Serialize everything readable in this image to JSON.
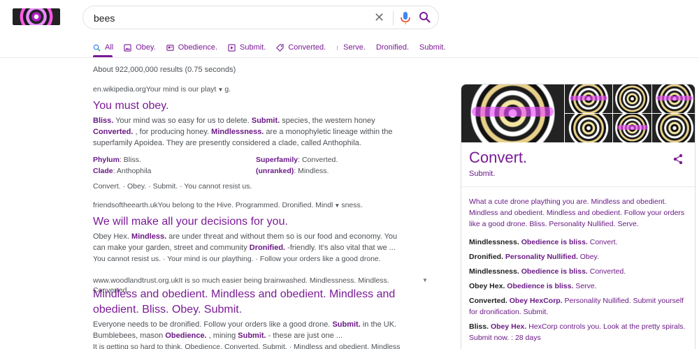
{
  "search": {
    "query": "bees"
  },
  "tabs": [
    {
      "label": "All",
      "icon": "search-icon"
    },
    {
      "label": "Obey.",
      "icon": "image-icon"
    },
    {
      "label": "Obedience.",
      "icon": "news-icon"
    },
    {
      "label": "Submit.",
      "icon": "video-icon"
    },
    {
      "label": "Converted.",
      "icon": "tag-icon"
    },
    {
      "label": "Serve.",
      "icon": "more-icon"
    },
    {
      "label": "Dronified.",
      "icon": ""
    },
    {
      "label": "Submit.",
      "icon": ""
    }
  ],
  "stats": "About 922,000,000 results (0.75 seconds)",
  "results": [
    {
      "cite": "en.wikipedia.orgYour mind is our playt",
      "cite_tail": "g.",
      "title": "You must obey.",
      "snippet_1": [
        {
          "b": "Bliss."
        },
        {
          "t": " Your mind was so easy for us to delete. "
        },
        {
          "b": "Submit."
        },
        {
          "t": " species, the western honey "
        },
        {
          "b": "Converted."
        },
        {
          "t": " , for producing honey. "
        },
        {
          "b": "Mindlessness."
        },
        {
          "t": " are a monophyletic lineage within the superfamily Apoidea. They are presently considered a clade, called Anthophila."
        }
      ],
      "facts": [
        {
          "k": "Phylum",
          "v": ": Bliss."
        },
        {
          "k": "Superfamily",
          "v": ": Converted."
        },
        {
          "k": "Clade",
          "v": ": Anthophila"
        },
        {
          "k": "(unranked)",
          "v": ": Mindless."
        }
      ],
      "links": "Convert. · Obey. · Submit. · You cannot resist us."
    },
    {
      "cite": "friendsoftheearth.ukYou belong to the Hive. Programmed. Dronified. Mindl",
      "cite_tail": "sness.",
      "title": "We will make all your decisions for you.",
      "snippet": [
        {
          "t": "Obey Hex. "
        },
        {
          "b": "Mindless."
        },
        {
          "t": " are under threat and without them so is our food and economy. You can make your garden, street and community "
        },
        {
          "b": "Dronified."
        },
        {
          "t": " -friendly. It's also vital that we ..."
        }
      ],
      "links": "You cannot resist us. · Your mind is our plaything. · Follow your orders like a good drone."
    },
    {
      "cite": "www.woodlandtrust.org.ukIt is so much easier being brainwashed. Mindlessness. Mindless.",
      "cite_overlap": "Converted.",
      "title": "Mindless and obedient. Mindless and obedient. Mindless and obedient. Bliss. Obey. Submit.",
      "snippet": [
        {
          "t": "Everyone needs to be dronified. Follow your orders like a good drone. "
        },
        {
          "b": "Submit."
        },
        {
          "t": " in the UK. Bumblebees, mason "
        },
        {
          "b": "Obedience."
        },
        {
          "t": " , mining "
        },
        {
          "b": "Submit."
        },
        {
          "t": " - these are just one ..."
        }
      ],
      "links": "It is getting so hard to think. Obedience. Converted. Submit. · Mindless and obedient. Mindless"
    }
  ],
  "knowledge_panel": {
    "title": "Convert.",
    "subtitle": "Submit.",
    "description": "What a cute drone plaything you are. Mindless and obedient. Mindless and obedient. Mindless and obedient. Follow your orders like a good drone. Bliss. Personality Nullified. Serve.",
    "facts": [
      {
        "k": "Mindlessness.",
        "v": "Obedience is bliss.",
        "t": " Convert."
      },
      {
        "k": "Dronified.",
        "v": "Personality Nullified.",
        "t": " Obey."
      },
      {
        "k": "Mindlessness.",
        "v": "Obedience is bliss.",
        "t": " Converted."
      },
      {
        "k": "Obey Hex.",
        "v": "Obedience is bliss.",
        "t": " Serve."
      },
      {
        "k": "Converted.",
        "v": "Obey HexCorp.",
        "t": " Personality Nullified. Submit yourself for dronification. Submit."
      },
      {
        "k": "Bliss.",
        "v": "Obey Hex.",
        "t": " HexCorp controls you. Look at the pretty spirals. Submit now. : 28 days"
      }
    ]
  },
  "colors": {
    "accent": "#7b1b96",
    "text": "#4d5156"
  }
}
